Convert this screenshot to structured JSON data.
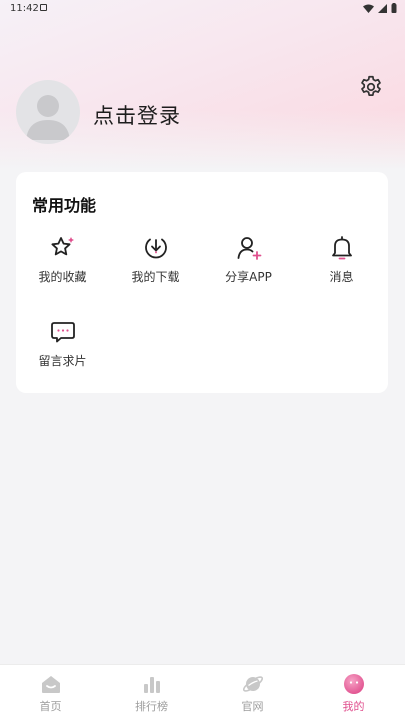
{
  "status_bar": {
    "time": "11:42"
  },
  "profile": {
    "login_label": "点击登录"
  },
  "features": {
    "title": "常用功能",
    "items": [
      {
        "label": "我的收藏",
        "icon": "star-icon"
      },
      {
        "label": "我的下载",
        "icon": "download-icon"
      },
      {
        "label": "分享APP",
        "icon": "add-user-icon"
      },
      {
        "label": "消息",
        "icon": "bell-icon"
      },
      {
        "label": "留言求片",
        "icon": "chat-icon"
      }
    ]
  },
  "tabbar": {
    "items": [
      {
        "label": "首页",
        "icon": "home-icon"
      },
      {
        "label": "排行榜",
        "icon": "bar-chart-icon"
      },
      {
        "label": "官网",
        "icon": "planet-icon"
      },
      {
        "label": "我的",
        "icon": "profile-face-icon"
      }
    ],
    "active_index": 3
  },
  "colors": {
    "accent": "#e0508e",
    "inactive": "#9c9c9c",
    "card": "#ffffff",
    "background": "#f4f4f6"
  }
}
